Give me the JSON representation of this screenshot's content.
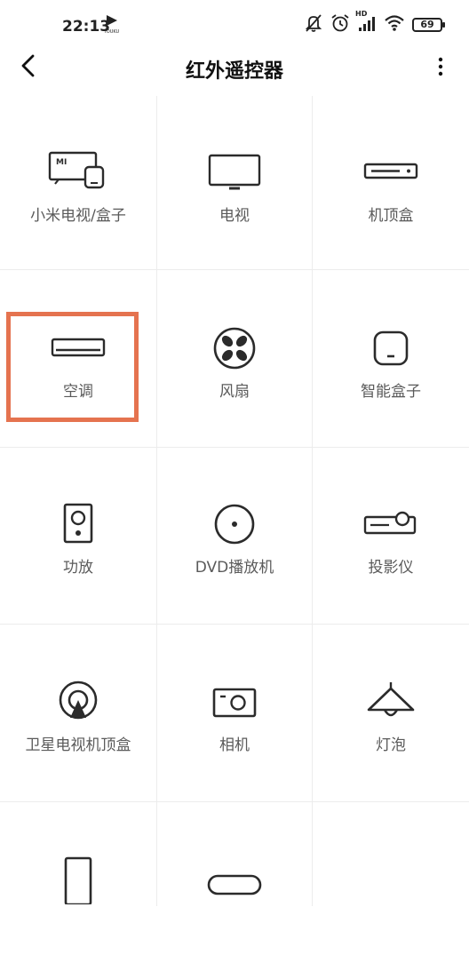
{
  "status_bar": {
    "time": "22:13",
    "battery": "69",
    "network_label": "HD",
    "icons": [
      "youku-icon",
      "mute-icon",
      "alarm-icon",
      "signal-icon",
      "wifi-icon",
      "battery-icon"
    ]
  },
  "nav": {
    "title": "红外遥控器",
    "back_icon": "chevron-left-icon",
    "more_icon": "more-vertical-icon"
  },
  "devices": [
    {
      "label": "小米电视/盒子",
      "icon": "mi-tv-box-icon"
    },
    {
      "label": "电视",
      "icon": "tv-icon"
    },
    {
      "label": "机顶盒",
      "icon": "set-top-box-icon"
    },
    {
      "label": "空调",
      "icon": "air-conditioner-icon",
      "highlighted": true
    },
    {
      "label": "风扇",
      "icon": "fan-icon"
    },
    {
      "label": "智能盒子",
      "icon": "smart-box-icon"
    },
    {
      "label": "功放",
      "icon": "amplifier-icon"
    },
    {
      "label": "DVD播放机",
      "icon": "dvd-player-icon"
    },
    {
      "label": "投影仪",
      "icon": "projector-icon"
    },
    {
      "label": "卫星电视机顶盒",
      "icon": "satellite-receiver-icon"
    },
    {
      "label": "相机",
      "icon": "camera-icon"
    },
    {
      "label": "灯泡",
      "icon": "lamp-icon"
    },
    {
      "label": "",
      "icon": "air-purifier-icon"
    },
    {
      "label": "",
      "icon": "sound-bar-icon"
    }
  ],
  "colors": {
    "highlight": "#e5734f",
    "icon": "#2b2b2b",
    "label": "#5a5a5a",
    "divider": "#ececec"
  }
}
